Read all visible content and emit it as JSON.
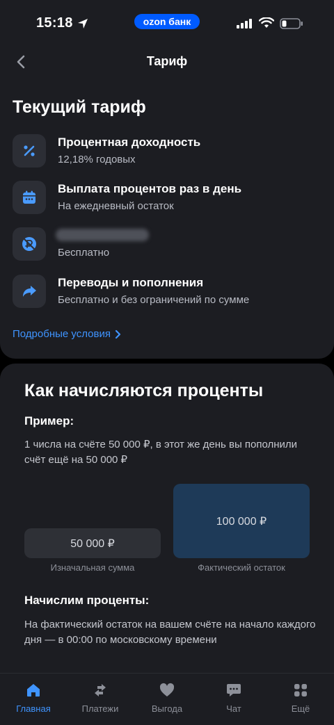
{
  "status_bar": {
    "time": "15:18",
    "brand_pill": "ozon банк",
    "colors": {
      "brand": "#005bff"
    },
    "icons": [
      "location-arrow-icon",
      "cellular-signal-icon",
      "wifi-icon",
      "battery-icon"
    ]
  },
  "header": {
    "title": "Тариф",
    "back_icon": "chevron-left-icon"
  },
  "current_tariff": {
    "title": "Текущий тариф",
    "items": [
      {
        "icon": "percent-icon",
        "title": "Процентная доходность",
        "subtitle": "12,18% годовых"
      },
      {
        "icon": "calendar-icon",
        "title": "Выплата процентов раз в день",
        "subtitle": "На ежедневный остаток"
      },
      {
        "icon": "no-fee-icon",
        "title": "",
        "subtitle": "Бесплатно"
      },
      {
        "icon": "transfer-arrow-icon",
        "title": "Переводы и пополнения",
        "subtitle": "Бесплатно и без ограничений по сумме"
      }
    ],
    "details_link": "Подробные условия"
  },
  "interest_explainer": {
    "title": "Как начисляются проценты",
    "example_label": "Пример:",
    "example_text": "1 числа на счёте 50 000 ₽, в этот же день вы пополнили счёт ещё на 50 000 ₽",
    "boxes": [
      {
        "value": "50 000 ₽",
        "caption": "Изначальная сумма"
      },
      {
        "value": "100 000 ₽",
        "caption": "Фактический остаток"
      }
    ],
    "accrual_label": "Начислим проценты:",
    "accrual_text": "На фактический остаток на вашем счёте на начало каждого дня — в 00:00 по московскому времени"
  },
  "tab_bar": {
    "active_color": "#3f94ff",
    "items": [
      {
        "icon": "home-icon",
        "label": "Главная",
        "active": true
      },
      {
        "icon": "transfer-icon",
        "label": "Платежи",
        "active": false
      },
      {
        "icon": "heart-icon",
        "label": "Выгода",
        "active": false
      },
      {
        "icon": "chat-icon",
        "label": "Чат",
        "active": false
      },
      {
        "icon": "grid-icon",
        "label": "Ещё",
        "active": false
      }
    ]
  }
}
